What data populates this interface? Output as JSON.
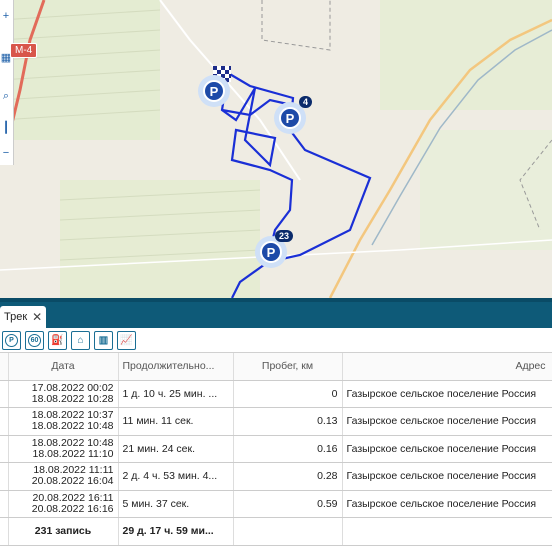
{
  "map": {
    "road_label": "M-4",
    "markers": [
      {
        "icon": "parking-icon",
        "letter": "P",
        "count": ""
      },
      {
        "icon": "parking-icon",
        "letter": "P",
        "count": "4"
      },
      {
        "icon": "parking-icon",
        "letter": "P",
        "count": "23"
      }
    ],
    "route_color": "#1a2fd6",
    "finish_icon": "checkered-flag-icon"
  },
  "tabs": [
    {
      "label": "Трек",
      "close": "✕"
    }
  ],
  "toolbar": {
    "buttons": [
      {
        "icon": "parking-icon",
        "glyph": "P"
      },
      {
        "icon": "speed-60-icon",
        "glyph": "60"
      },
      {
        "icon": "fuel-icon",
        "glyph": "⛽"
      },
      {
        "icon": "route-icon",
        "glyph": "⌂"
      },
      {
        "icon": "columns-icon",
        "glyph": "▥"
      },
      {
        "icon": "chart-icon",
        "glyph": "📈"
      }
    ]
  },
  "table": {
    "columns": [
      "",
      "Дата",
      "Продолжительно...",
      "Пробег, км",
      "Адрес"
    ],
    "rows": [
      {
        "date1": "17.08.2022 00:02",
        "date2": "18.08.2022 10:28",
        "duration": "1 д. 10 ч. 25 мин. ...",
        "distance": "0",
        "address": "Газырское сельское поселение Россия"
      },
      {
        "date1": "18.08.2022 10:37",
        "date2": "18.08.2022 10:48",
        "duration": "11 мин. 11 сек.",
        "distance": "0.13",
        "address": "Газырское сельское поселение Россия"
      },
      {
        "date1": "18.08.2022 10:48",
        "date2": "18.08.2022 11:10",
        "duration": "21 мин. 24 сек.",
        "distance": "0.16",
        "address": "Газырское сельское поселение Россия"
      },
      {
        "date1": "18.08.2022 11:11",
        "date2": "20.08.2022 16:04",
        "duration": "2 д. 4 ч. 53 мин. 4...",
        "distance": "0.28",
        "address": "Газырское сельское поселение Россия"
      },
      {
        "date1": "20.08.2022 16:11",
        "date2": "20.08.2022 16:16",
        "duration": "5 мин. 37 сек.",
        "distance": "0.59",
        "address": "Газырское сельское поселение Россия"
      }
    ],
    "footer": {
      "count": "231 запись",
      "duration": "29 д. 17 ч. 59 ми..."
    }
  }
}
